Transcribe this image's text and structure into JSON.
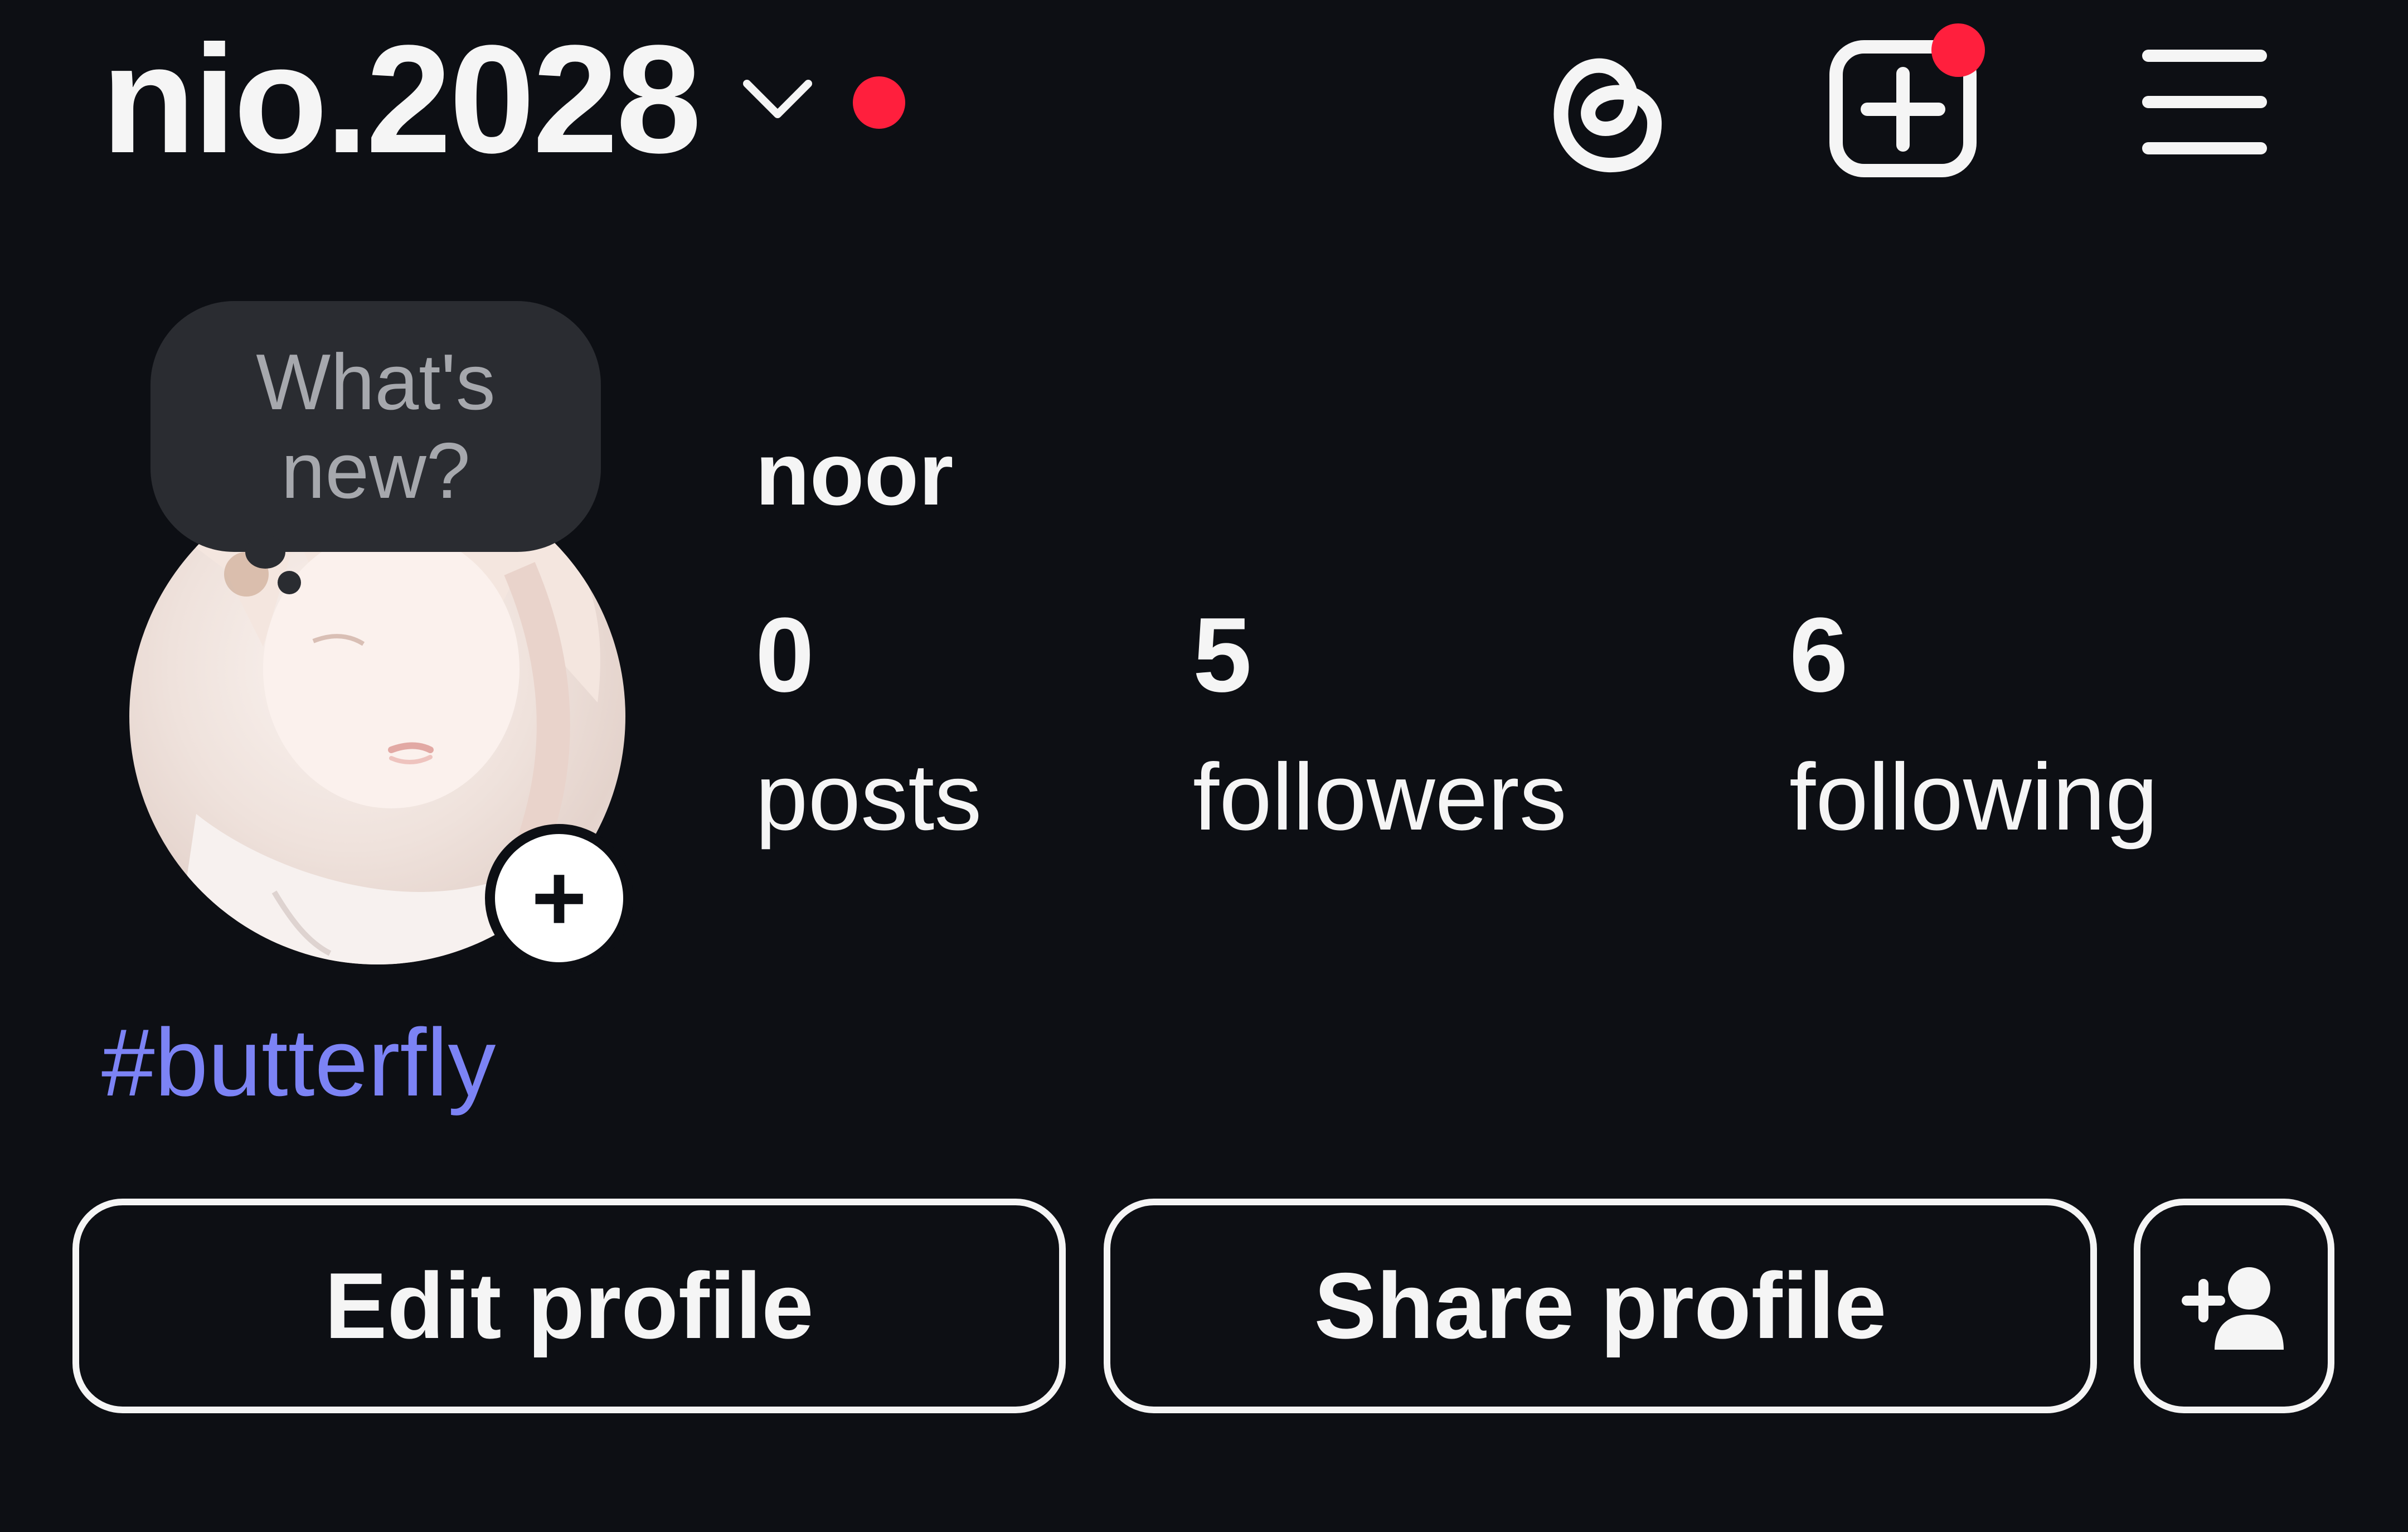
{
  "header": {
    "username": "nio.2028",
    "icons": [
      "chevron-down-icon",
      "threads-icon",
      "create-icon",
      "menu-icon"
    ],
    "notification_color": "#ff1f3d"
  },
  "profile": {
    "display_name": "noor",
    "bubble_text": "What's new?",
    "hashtag": "#butterfly",
    "hashtag_color": "#7c83f5",
    "avatar_add_symbol": "+"
  },
  "stats": {
    "posts": {
      "value": "0",
      "label": "posts"
    },
    "followers": {
      "value": "5",
      "label": "followers"
    },
    "following": {
      "value": "6",
      "label": "following"
    }
  },
  "actions": {
    "edit_label": "Edit profile",
    "share_label": "Share profile",
    "add_user_icon": "add-person-icon"
  },
  "colors": {
    "background": "#0d0f14",
    "foreground": "#f5f5f5",
    "bubble": "#2a2c31"
  }
}
